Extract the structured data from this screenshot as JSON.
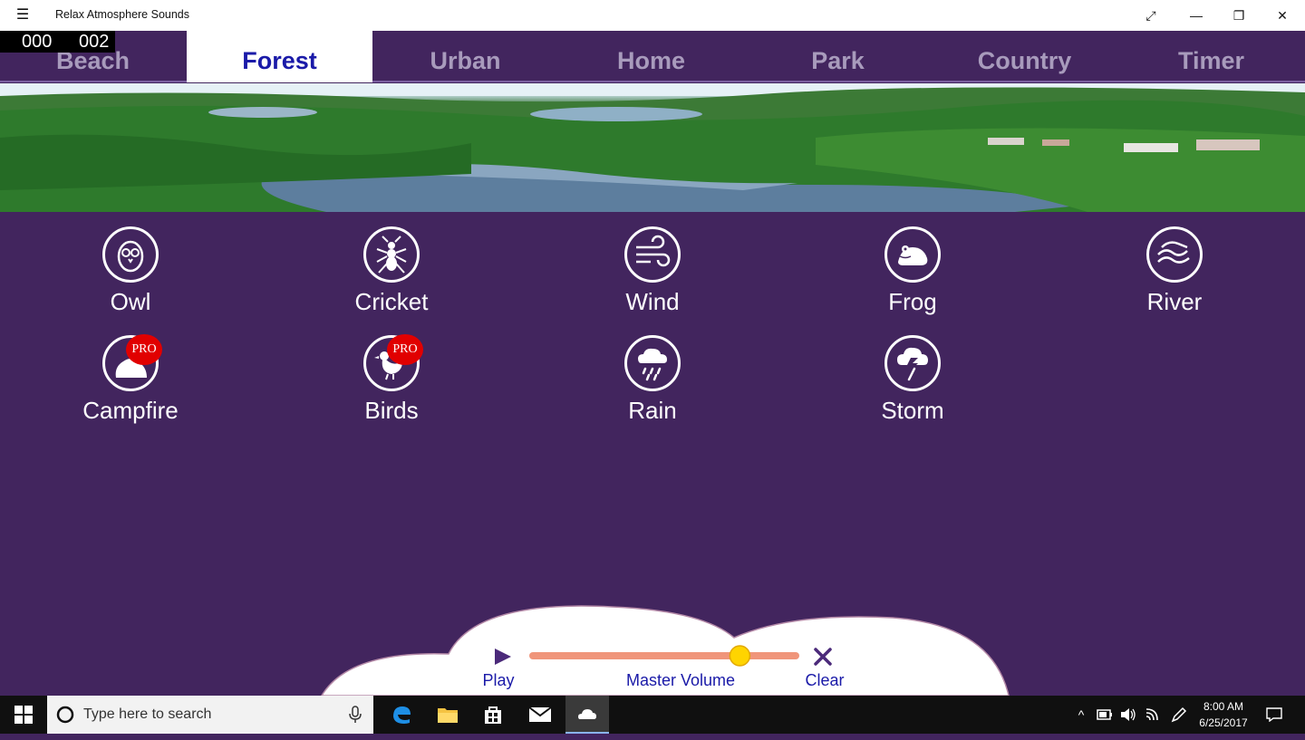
{
  "window": {
    "title": "Relax Atmosphere Sounds",
    "hamburger_glyph": "☰",
    "buttons": {
      "fullscreen": "⤢",
      "minimize": "—",
      "restore": "❐",
      "close": "✕"
    }
  },
  "counter": {
    "left": "000",
    "right": "002"
  },
  "tabs": [
    {
      "label": "Beach",
      "active": false
    },
    {
      "label": "Forest",
      "active": true
    },
    {
      "label": "Urban",
      "active": false
    },
    {
      "label": "Home",
      "active": false
    },
    {
      "label": "Park",
      "active": false
    },
    {
      "label": "Country",
      "active": false
    },
    {
      "label": "Timer",
      "active": false
    }
  ],
  "sounds": [
    {
      "label": "Owl",
      "icon": "owl-icon",
      "pro": false
    },
    {
      "label": "Cricket",
      "icon": "cricket-icon",
      "pro": false
    },
    {
      "label": "Wind",
      "icon": "wind-icon",
      "pro": false
    },
    {
      "label": "Frog",
      "icon": "frog-icon",
      "pro": false
    },
    {
      "label": "River",
      "icon": "river-icon",
      "pro": false
    },
    {
      "label": "Campfire",
      "icon": "campfire-icon",
      "pro": true,
      "pro_label": "PRO"
    },
    {
      "label": "Birds",
      "icon": "bird-icon",
      "pro": true,
      "pro_label": "PRO"
    },
    {
      "label": "Rain",
      "icon": "rain-icon",
      "pro": false
    },
    {
      "label": "Storm",
      "icon": "storm-icon",
      "pro": false
    }
  ],
  "player": {
    "play_label": "Play",
    "volume_label": "Master Volume",
    "clear_label": "Clear",
    "volume_level": 0.8
  },
  "taskbar": {
    "search_placeholder": "Type here to search",
    "time": "8:00 AM",
    "date": "6/25/2017"
  },
  "colors": {
    "background": "#42255e",
    "active_tab_text": "#1a1aa8",
    "inactive_tab_text": "#a89bbc",
    "pro_badge": "#e10000",
    "slider_track": "#f0957a",
    "slider_thumb": "#ffd400"
  }
}
